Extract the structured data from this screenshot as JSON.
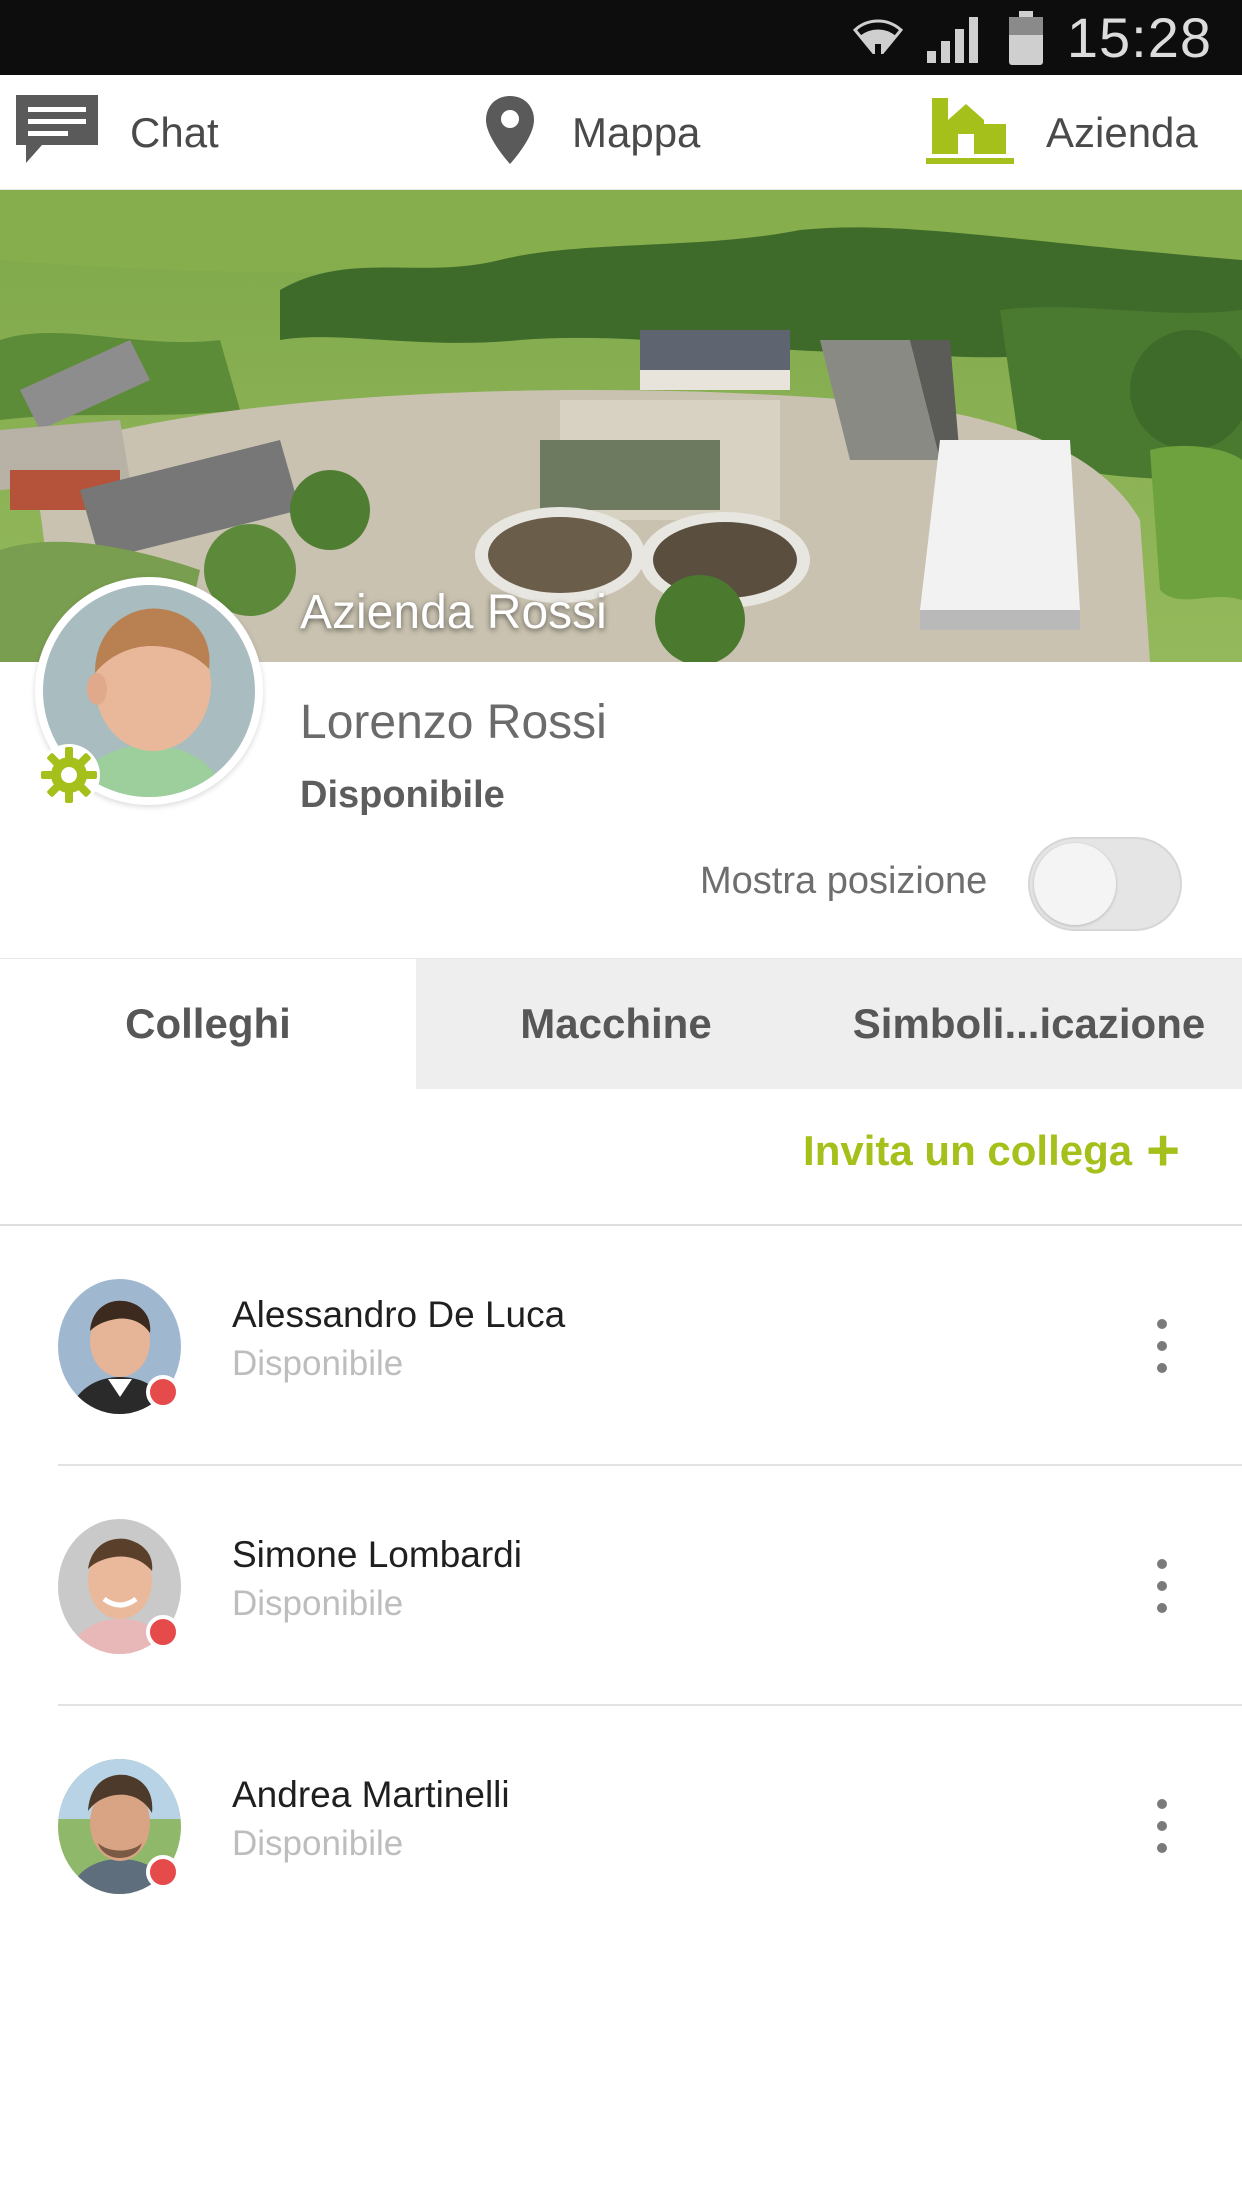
{
  "status_bar": {
    "time": "15:28",
    "icons": [
      "wifi-icon",
      "signal-icon",
      "battery-icon"
    ]
  },
  "nav": {
    "items": [
      {
        "label": "Chat",
        "icon": "chat-icon"
      },
      {
        "label": "Mappa",
        "icon": "map-pin-icon"
      },
      {
        "label": "Azienda",
        "icon": "farm-icon",
        "active": true
      }
    ],
    "active_color": "#a6c01b"
  },
  "company": {
    "name": "Azienda Rossi"
  },
  "profile": {
    "name": "Lorenzo Rossi",
    "status": "Disponibile",
    "show_position_label": "Mostra posizione",
    "show_position": false
  },
  "tabs": [
    {
      "label": "Colleghi",
      "active": true
    },
    {
      "label": "Macchine",
      "active": false
    },
    {
      "label": "Simboli...icazione",
      "active": false
    }
  ],
  "invite": {
    "label": "Invita un collega",
    "icon": "plus-icon"
  },
  "colleagues": [
    {
      "name": "Alessandro De Luca",
      "status": "Disponibile"
    },
    {
      "name": "Simone Lombardi",
      "status": "Disponibile"
    },
    {
      "name": "Andrea Martinelli",
      "status": "Disponibile"
    }
  ],
  "colors": {
    "accent": "#a6c01b",
    "status_dot": "#e54b4b"
  }
}
